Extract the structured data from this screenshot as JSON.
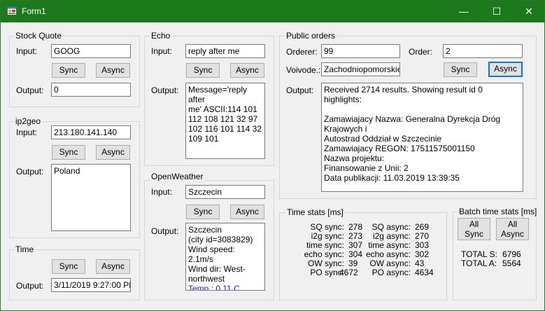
{
  "window": {
    "title": "Form1",
    "minimize": "—",
    "maximize": "☐",
    "close": "✕"
  },
  "stock": {
    "title": "Stock Quote",
    "input_label": "Input:",
    "input_value": "GOOG",
    "sync": "Sync",
    "async": "Async",
    "output_label": "Output:",
    "output_value": "0"
  },
  "ip2geo": {
    "title": "ip2geo",
    "input_label": "Input:",
    "input_value": "213.180.141.140",
    "sync": "Sync",
    "async": "Async",
    "output_label": "Output:",
    "output_value": "Poland"
  },
  "time": {
    "title": "Time",
    "sync": "Sync",
    "async": "Async",
    "output_label": "Output:",
    "output_value": "3/11/2019 9:27:00 PM"
  },
  "echo": {
    "title": "Echo",
    "input_label": "Input:",
    "input_value": "reply after me",
    "sync": "Sync",
    "async": "Async",
    "output_label": "Output:",
    "output_lines": [
      "Message='reply after",
      "me' ASCII:114 101",
      "112 108 121 32 97",
      "102 116 101 114 32",
      "109 101"
    ]
  },
  "weather": {
    "title": "OpenWeather",
    "input_label": "Input:",
    "input_value": "Szczecin",
    "sync": "Sync",
    "async": "Async",
    "output_label": "Output:",
    "output_lines": [
      "Szczecin",
      "(city id=3083829)",
      "Wind speed: 2.1m/s",
      "Wind dir: West-",
      "northwest"
    ],
    "temp_line": "Temp.: 0.11 C"
  },
  "orders": {
    "title": "Public orders",
    "orderer_label": "Orderer:",
    "orderer_value": "99",
    "order_label": "Order:",
    "order_value": "2",
    "voivode_label": "Voivode.:",
    "voivode_value": "Zachodniopomorskie",
    "sync": "Sync",
    "async": "Async",
    "output_label": "Output:",
    "output_lines": [
      "Received 2714 results. Showing result id 0 highlights:",
      "",
      "Zamawiajacy Nazwa: Generalna Dyrekcja Dróg Krajowych i",
      "Autostrad Oddział w Szczecinie",
      "Zamawiajacy REGON: 17511575001150",
      "Nazwa projektu:",
      "Finansowanie z Unii: 2",
      "Data publikacji: 11.03.2019 13:39:35"
    ]
  },
  "time_stats": {
    "title": "Time stats [ms]",
    "sync": [
      {
        "label": "SQ sync:",
        "value": "278"
      },
      {
        "label": "i2g sync:",
        "value": "273"
      },
      {
        "label": "time sync:",
        "value": "307"
      },
      {
        "label": "echo sync:",
        "value": "304"
      },
      {
        "label": "OW sync:",
        "value": "39"
      },
      {
        "label": "PO sync:",
        "value": "4672"
      }
    ],
    "async": [
      {
        "label": "SQ async:",
        "value": "269"
      },
      {
        "label": "i2g async:",
        "value": "270"
      },
      {
        "label": "time async:",
        "value": "303"
      },
      {
        "label": "echo async:",
        "value": "302"
      },
      {
        "label": "OW async:",
        "value": "43"
      },
      {
        "label": "PO async:",
        "value": "4634"
      }
    ]
  },
  "batch": {
    "title": "Batch time stats [ms]",
    "all_sync": [
      "All",
      "Sync"
    ],
    "all_async": [
      "All",
      "Async"
    ],
    "total_s_label": "TOTAL S:",
    "total_s_value": "6796",
    "total_a_label": "TOTAL A:",
    "total_a_value": "5564"
  },
  "colors": {
    "titlebar": "#1c7a1c",
    "focus": "#0078d7",
    "temp_text": "#1a1aff"
  }
}
